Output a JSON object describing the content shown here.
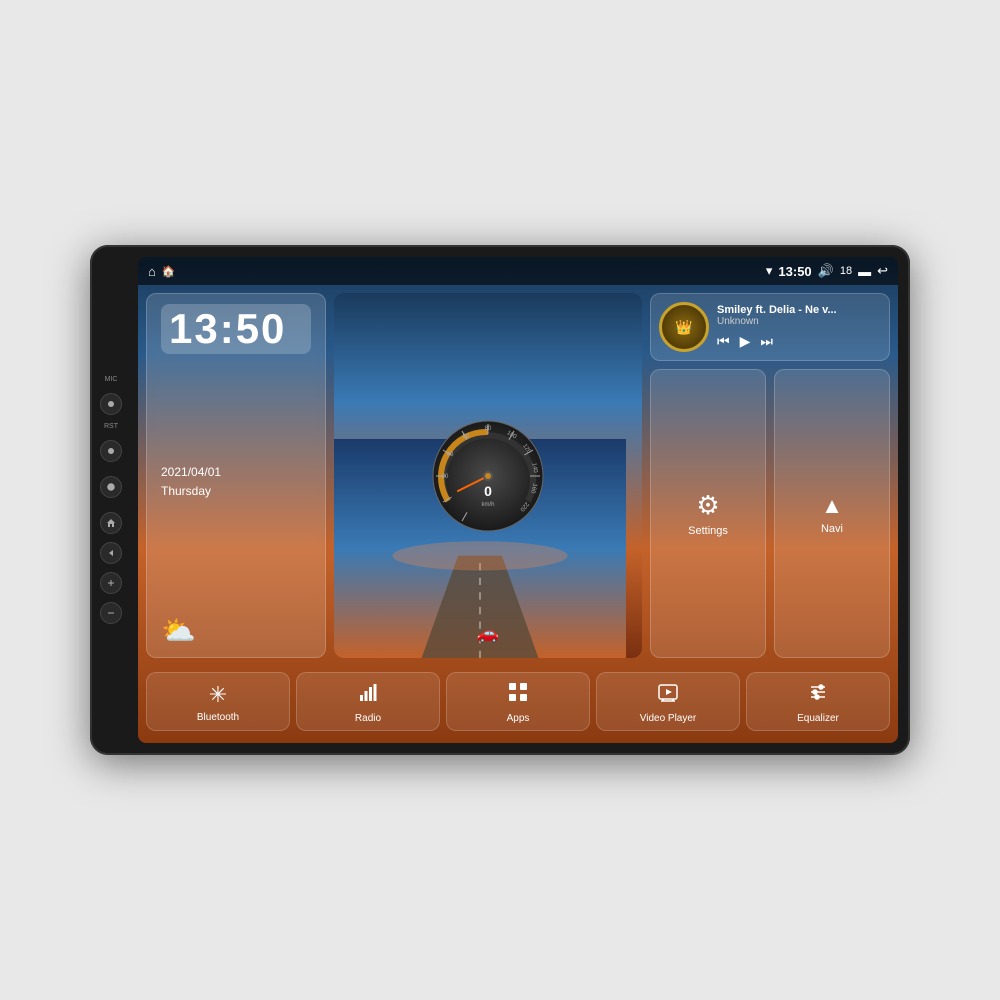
{
  "device": {
    "side_labels": [
      "MIC",
      "RST"
    ]
  },
  "status_bar": {
    "home_icon": "⌂",
    "house_icon": "🏠",
    "wifi_icon": "▾",
    "time": "13:50",
    "volume_icon": "🔊",
    "volume_level": "18",
    "battery_icon": "🔋",
    "back_icon": "↩"
  },
  "clock": {
    "time": "13:50",
    "date": "2021/04/01",
    "day": "Thursday",
    "weather": "⛅"
  },
  "music": {
    "title": "Smiley ft. Delia - Ne v...",
    "artist": "Unknown",
    "prev": "⏮",
    "play": "▶",
    "next": "⏭",
    "album_icon": "👑"
  },
  "settings_btn": {
    "icon": "⚙",
    "label": "Settings"
  },
  "navi_btn": {
    "icon": "▲",
    "label": "Navi"
  },
  "bottom_buttons": [
    {
      "id": "bluetooth",
      "icon": "✳",
      "label": "Bluetooth"
    },
    {
      "id": "radio",
      "icon": "📶",
      "label": "Radio"
    },
    {
      "id": "apps",
      "icon": "⊞",
      "label": "Apps"
    },
    {
      "id": "video-player",
      "icon": "📺",
      "label": "Video Player"
    },
    {
      "id": "equalizer",
      "icon": "⚌",
      "label": "Equalizer"
    }
  ],
  "speedo": {
    "value": "0",
    "unit": "km/h"
  }
}
